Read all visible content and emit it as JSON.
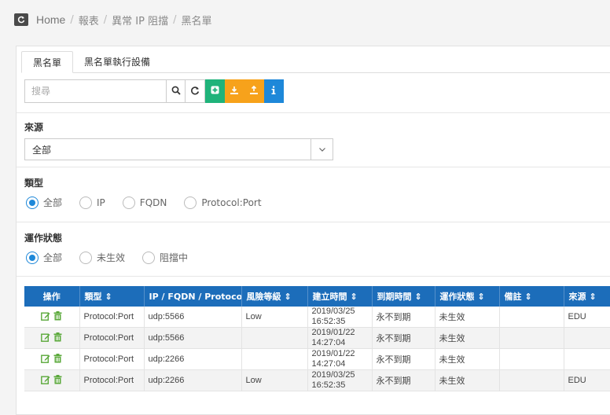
{
  "breadcrumb": {
    "home": "Home",
    "items": [
      "報表",
      "異常 IP 阻擋",
      "黑名單"
    ],
    "separator": "/"
  },
  "tabs": [
    {
      "label": "黑名單",
      "active": true
    },
    {
      "label": "黑名單執行設備",
      "active": false
    }
  ],
  "search": {
    "placeholder": "搜尋",
    "value": ""
  },
  "toolbar_buttons": [
    {
      "icon": "search-icon",
      "color": "#ffffff"
    },
    {
      "icon": "refresh-icon",
      "color": "#ffffff"
    },
    {
      "icon": "add-icon",
      "color": "#1fb37a"
    },
    {
      "icon": "import-icon",
      "color": "#f7a21b"
    },
    {
      "icon": "export-icon",
      "color": "#f7a21b"
    },
    {
      "icon": "info-icon",
      "color": "#1e88d9"
    }
  ],
  "source": {
    "label": "來源",
    "selected": "全部"
  },
  "type_filter": {
    "label": "類型",
    "options": [
      {
        "label": "全部",
        "checked": true
      },
      {
        "label": "IP",
        "checked": false
      },
      {
        "label": "FQDN",
        "checked": false
      },
      {
        "label": "Protocol:Port",
        "checked": false
      }
    ]
  },
  "status_filter": {
    "label": "運作狀態",
    "options": [
      {
        "label": "全部",
        "checked": true
      },
      {
        "label": "未生效",
        "checked": false
      },
      {
        "label": "阻擋中",
        "checked": false
      }
    ]
  },
  "table": {
    "headers": [
      "操作",
      "類型 ⇕",
      "IP / FQDN / Protocol",
      "風險等級 ⇕",
      "建立時間 ⇕",
      "到期時間 ⇕",
      "運作狀態 ⇕",
      "備註 ⇕",
      "來源 ⇕"
    ],
    "rows": [
      {
        "type": "Protocol:Port",
        "target": "udp:5566",
        "risk": "Low",
        "created_date": "2019/03/25",
        "created_time": "16:52:35",
        "expire": "永不到期",
        "status": "未生效",
        "note": "",
        "source": "EDU"
      },
      {
        "type": "Protocol:Port",
        "target": "udp:5566",
        "risk": "",
        "created_date": "2019/01/22",
        "created_time": "14:27:04",
        "expire": "永不到期",
        "status": "未生效",
        "note": "",
        "source": ""
      },
      {
        "type": "Protocol:Port",
        "target": "udp:2266",
        "risk": "",
        "created_date": "2019/01/22",
        "created_time": "14:27:04",
        "expire": "永不到期",
        "status": "未生效",
        "note": "",
        "source": ""
      },
      {
        "type": "Protocol:Port",
        "target": "udp:2266",
        "risk": "Low",
        "created_date": "2019/03/25",
        "created_time": "16:52:35",
        "expire": "永不到期",
        "status": "未生效",
        "note": "",
        "source": "EDU"
      }
    ]
  },
  "colors": {
    "header_bg": "#1c6dba",
    "edit_icon": "#5aa83a",
    "delete_icon": "#5aa83a",
    "radio_checked": "#1e88d9"
  }
}
